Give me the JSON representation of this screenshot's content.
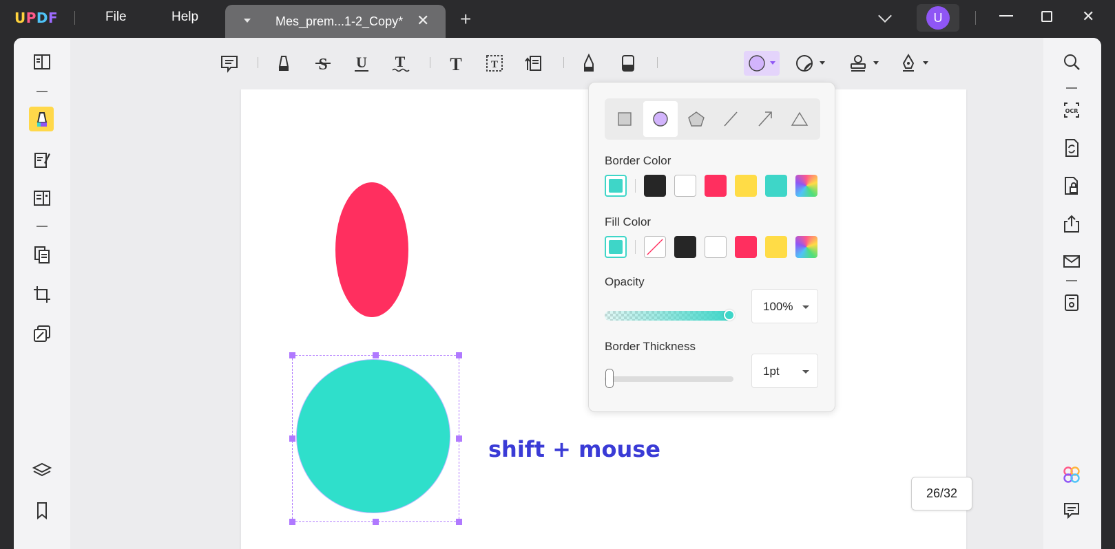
{
  "app": {
    "logo": "UPDF",
    "menu": [
      "File",
      "Help"
    ],
    "tab_title": "Mes_prem...1-2_Copy*",
    "avatar_letter": "U"
  },
  "canvas": {
    "annotation_text": "shift + mouse",
    "page_indicator": "26/32",
    "shape_colors": {
      "ellipse": "#ff2f5f",
      "circle": "#2fdfcb",
      "text": "#3a3bd6"
    }
  },
  "shape_panel": {
    "shapes": [
      "rectangle",
      "ellipse",
      "polygon",
      "line",
      "arrow",
      "triangle"
    ],
    "selected_shape": "ellipse",
    "border_color_label": "Border Color",
    "border_colors": [
      "#3ed6c8",
      "#262626",
      "#ffffff",
      "#ff2f5f",
      "#ffdc46",
      "#3ed6c8",
      "gradient"
    ],
    "fill_color_label": "Fill Color",
    "fill_colors": [
      "#3ed6c8",
      "none",
      "#262626",
      "#ffffff",
      "#ff2f5f",
      "#ffdc46",
      "gradient"
    ],
    "opacity_label": "Opacity",
    "opacity_value": "100%",
    "opacity_level": 1.0,
    "thickness_label": "Border Thickness",
    "thickness_value": "1pt"
  },
  "toolbar": {
    "tools": [
      "comment-icon",
      "highlight-icon",
      "strikethrough-icon",
      "underline-icon",
      "squiggly-icon",
      "text-icon",
      "textbox-icon",
      "callout-icon",
      "pencil-icon",
      "eraser-icon",
      "shape-icon",
      "sticker-icon",
      "stamp-icon",
      "signature-icon"
    ],
    "active_tool": "shape-icon"
  }
}
